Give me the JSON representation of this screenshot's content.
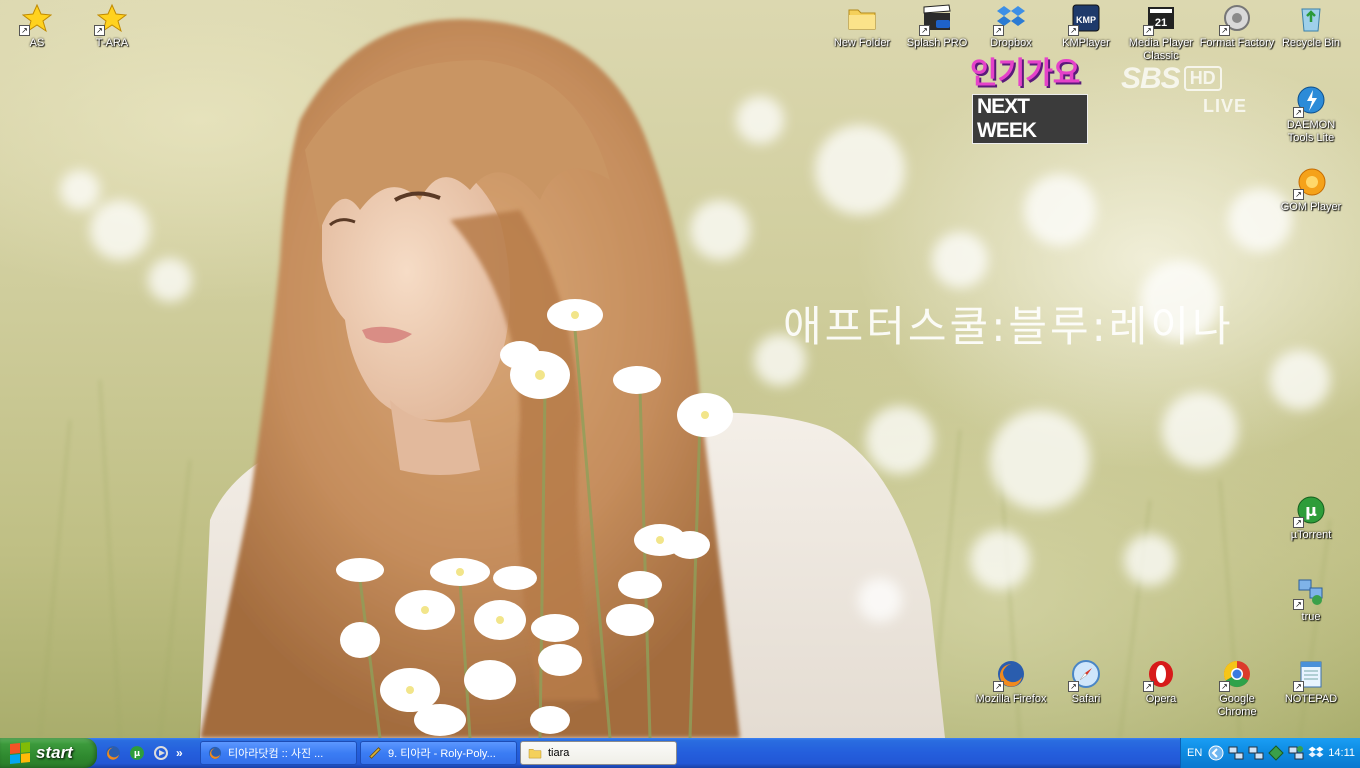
{
  "wallpaper": {
    "overlay_text": "애프터스쿨:블루:레이나",
    "tv_logo": {
      "title": "인기가요",
      "subtitle": "NEXT WEEK"
    },
    "watermark": {
      "brand": "SBS",
      "box": "HD",
      "live": "LIVE"
    }
  },
  "desktop_icons": {
    "as": {
      "label": "AS",
      "icon": "star-icon"
    },
    "tara": {
      "label": "T-ARA",
      "icon": "star-icon"
    },
    "new_folder": {
      "label": "New Folder",
      "icon": "folder-icon"
    },
    "splash_pro": {
      "label": "Splash PRO",
      "icon": "clapperboard-icon"
    },
    "dropbox": {
      "label": "Dropbox",
      "icon": "dropbox-icon"
    },
    "kmplayer": {
      "label": "KMPlayer",
      "icon": "kmplayer-icon"
    },
    "mpc": {
      "label": "Media Player Classic",
      "icon": "media-player-classic-icon"
    },
    "format_factory": {
      "label": "Format Factory",
      "icon": "format-factory-icon"
    },
    "recycle_bin": {
      "label": "Recycle Bin",
      "icon": "recycle-bin-icon"
    },
    "daemon_tools": {
      "label": "DAEMON Tools Lite",
      "icon": "daemon-tools-icon"
    },
    "gom_player": {
      "label": "GOM Player",
      "icon": "gom-player-icon"
    },
    "utorrent": {
      "label": "µTorrent",
      "icon": "utorrent-icon"
    },
    "true": {
      "label": "true",
      "icon": "network-icon"
    },
    "firefox": {
      "label": "Mozilla Firefox",
      "icon": "firefox-icon"
    },
    "safari": {
      "label": "Safari",
      "icon": "safari-icon"
    },
    "opera": {
      "label": "Opera",
      "icon": "opera-icon"
    },
    "chrome": {
      "label": "Google Chrome",
      "icon": "chrome-icon"
    },
    "notepad": {
      "label": "NOTEPAD",
      "icon": "notepad-icon"
    }
  },
  "taskbar": {
    "start_label": "start",
    "quick_launch_more": "»",
    "tasks": [
      {
        "label": "티아라닷컴 :: 사진 ...",
        "icon": "firefox-icon",
        "active": false
      },
      {
        "label": "9. 티아라 - Roly-Poly...",
        "icon": "kmplayer-icon",
        "active": false
      },
      {
        "label": "tiara",
        "icon": "folder-icon",
        "active": true
      }
    ],
    "tray": {
      "language": "EN",
      "time": "14:11"
    }
  },
  "colors": {
    "taskbar_blue": "#245edc",
    "start_green": "#3c9a3c",
    "tray_blue": "#0d8ae0"
  }
}
